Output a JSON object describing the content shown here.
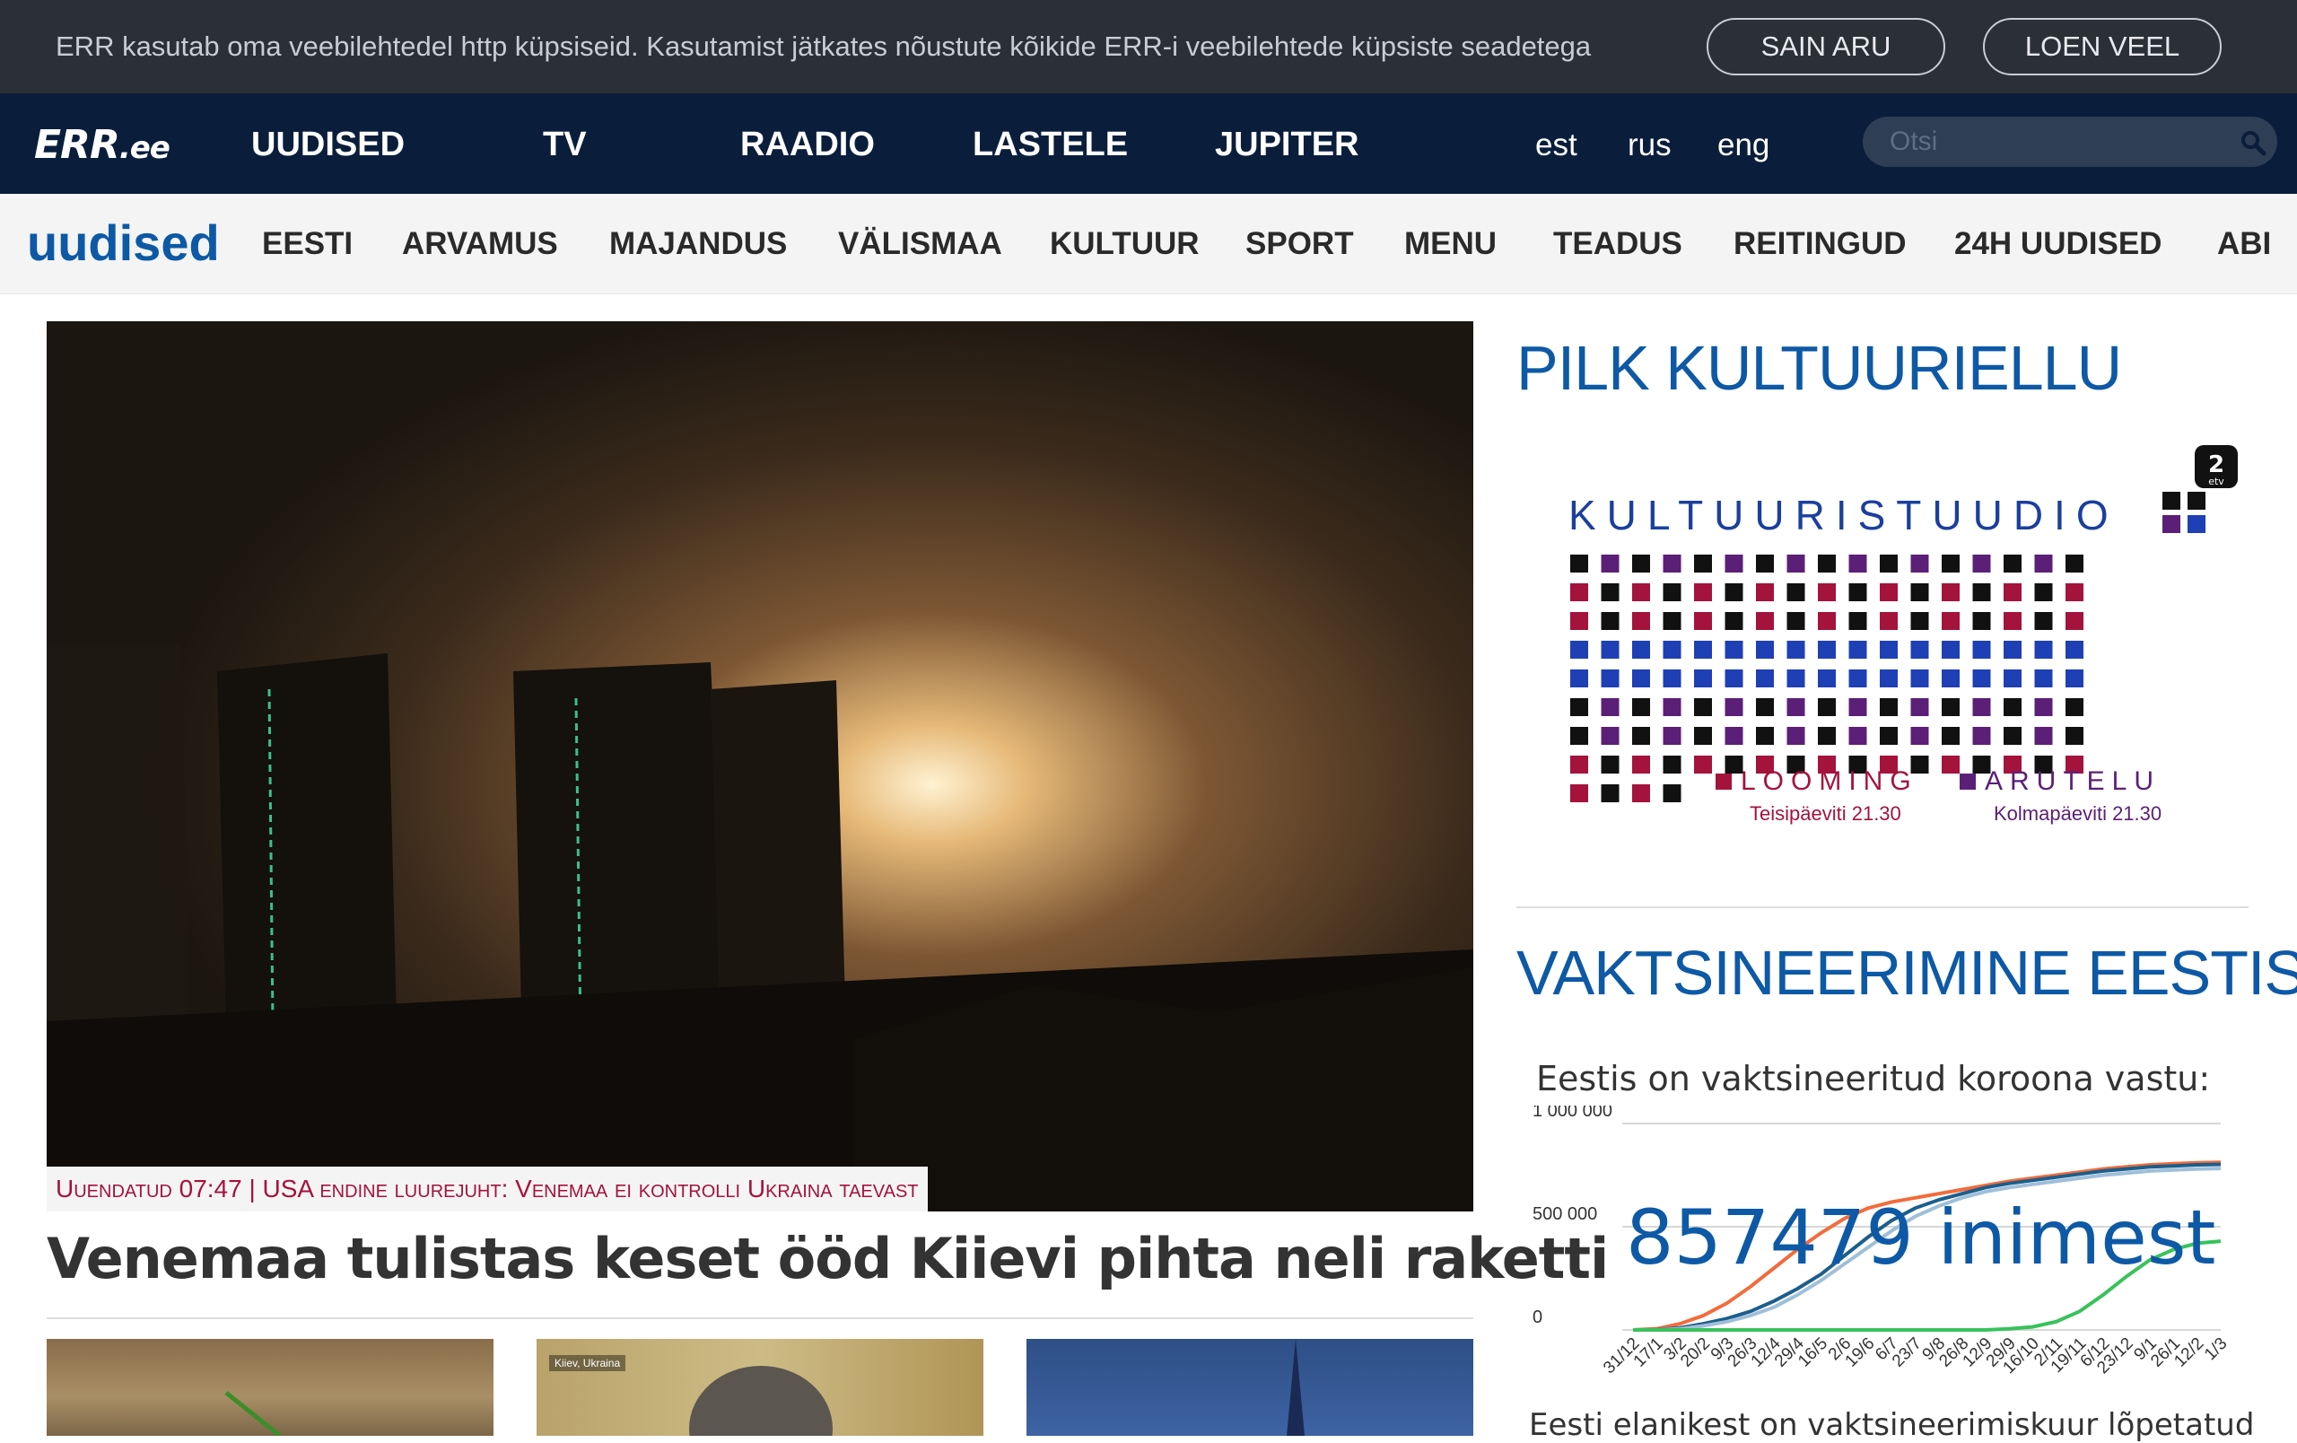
{
  "cookie": {
    "text": "ERR kasutab oma veebilehtedel http küpsiseid. Kasutamist jätkates nõustute kõikide ERR-i veebilehtede küpsiste seadetega",
    "accept_label": "SAIN ARU",
    "more_label": "LOEN VEEL"
  },
  "header": {
    "logo_main": "ERR",
    "logo_suffix": ".ee",
    "nav": [
      "UUDISED",
      "TV",
      "RAADIO",
      "LASTELE",
      "JUPITER"
    ],
    "langs": [
      "est",
      "rus",
      "eng"
    ],
    "search_placeholder": "Otsi"
  },
  "subnav": {
    "section": "uudised",
    "items": [
      "EESTI",
      "ARVAMUS",
      "MAJANDUS",
      "VÄLISMAA",
      "KULTUUR",
      "SPORT",
      "MENU",
      "TEADUS",
      "REITINGUD",
      "24H UUDISED",
      "ABI"
    ]
  },
  "hero": {
    "caption": "Uuendatud 07:47 | USA endine luurejuht: Venemaa ei kontrolli Ukraina taevast",
    "headline": "Venemaa tulistas keset ööd Kiievi pihta neli raketti",
    "thumb2_label": "Kiiev, Ukraina"
  },
  "sidebar": {
    "kultuur_heading": "PILK KULTUURIELLU",
    "banner": {
      "title": "KULTUURISTUUDIO",
      "show1": "LOOMING",
      "show1_time": "Teisipäeviti 21.30",
      "show2": "ARUTELU",
      "show2_time": "Kolmapäeviti 21.30",
      "channel_badge": "2 etv"
    },
    "vakts_heading": "VAKTSINEERIMINE EESTIS",
    "vakts_title": "Eestis on vaktsineeritud koroona vastu:",
    "vakts_count": "857479 inimest",
    "vakts_footer": "Eesti elanikest on vaktsineerimiskuur lõpetatud"
  },
  "chart_data": {
    "type": "line",
    "title": "Eestis on vaktsineeritud koroona vastu:",
    "x": [
      "31/12",
      "17/1",
      "3/2",
      "20/2",
      "9/3",
      "26/3",
      "12/4",
      "29/4",
      "16/5",
      "2/6",
      "19/6",
      "6/7",
      "23/7",
      "9/8",
      "26/8",
      "12/9",
      "29/9",
      "16/10",
      "2/11",
      "19/11",
      "6/12",
      "23/12",
      "9/1",
      "26/1",
      "12/2",
      "1/3"
    ],
    "y_ticks": [
      "0",
      "500 000",
      "1 000 000"
    ],
    "ylim": [
      0,
      1000000
    ],
    "series": [
      {
        "color": "#f26c3c",
        "values": [
          0,
          5000,
          30000,
          70000,
          130000,
          210000,
          300000,
          390000,
          470000,
          540000,
          590000,
          620000,
          640000,
          660000,
          680000,
          700000,
          720000,
          735000,
          750000,
          765000,
          780000,
          790000,
          800000,
          805000,
          810000,
          812000
        ]
      },
      {
        "color": "#1b5e8c",
        "values": [
          0,
          1000,
          10000,
          30000,
          55000,
          90000,
          140000,
          200000,
          270000,
          360000,
          450000,
          530000,
          590000,
          630000,
          660000,
          690000,
          710000,
          725000,
          740000,
          755000,
          770000,
          780000,
          790000,
          795000,
          800000,
          802000
        ]
      },
      {
        "color": "#9fbfd8",
        "values": [
          0,
          0,
          5000,
          20000,
          40000,
          70000,
          110000,
          170000,
          240000,
          320000,
          400000,
          480000,
          550000,
          600000,
          640000,
          670000,
          690000,
          705000,
          720000,
          735000,
          750000,
          760000,
          770000,
          775000,
          780000,
          782000
        ]
      },
      {
        "color": "#38c25b",
        "values": [
          0,
          0,
          0,
          0,
          0,
          0,
          0,
          0,
          0,
          0,
          0,
          0,
          0,
          0,
          0,
          0,
          5000,
          15000,
          40000,
          90000,
          170000,
          260000,
          340000,
          390000,
          420000,
          430000
        ]
      }
    ]
  }
}
